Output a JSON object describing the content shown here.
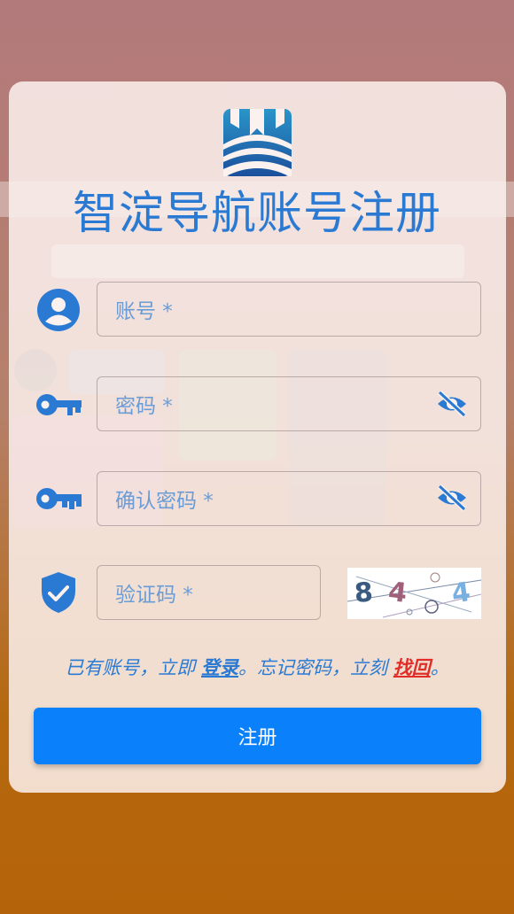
{
  "title": "智淀导航账号注册",
  "fields": {
    "account": {
      "placeholder": "账号 *"
    },
    "password": {
      "placeholder": "密码 *"
    },
    "confirm_password": {
      "placeholder": "确认密码 *"
    },
    "captcha": {
      "placeholder": "验证码 *"
    }
  },
  "captcha_image": {
    "chars": [
      "8",
      "4",
      "4"
    ]
  },
  "links": {
    "prefix": "已有账号，立即 ",
    "login": "登录",
    "middle": "。忘记密码，立刻 ",
    "recover": "找回",
    "suffix": "。"
  },
  "submit": {
    "label": "注册"
  },
  "icons": {
    "account": "user-circle-icon",
    "password": "key-icon",
    "confirm_password": "key-icon",
    "captcha": "shield-check-icon",
    "eye": "eye-slash-icon"
  },
  "colors": {
    "accent": "#2a7ad4",
    "button": "#0a80fa",
    "recover": "#e02d28"
  }
}
